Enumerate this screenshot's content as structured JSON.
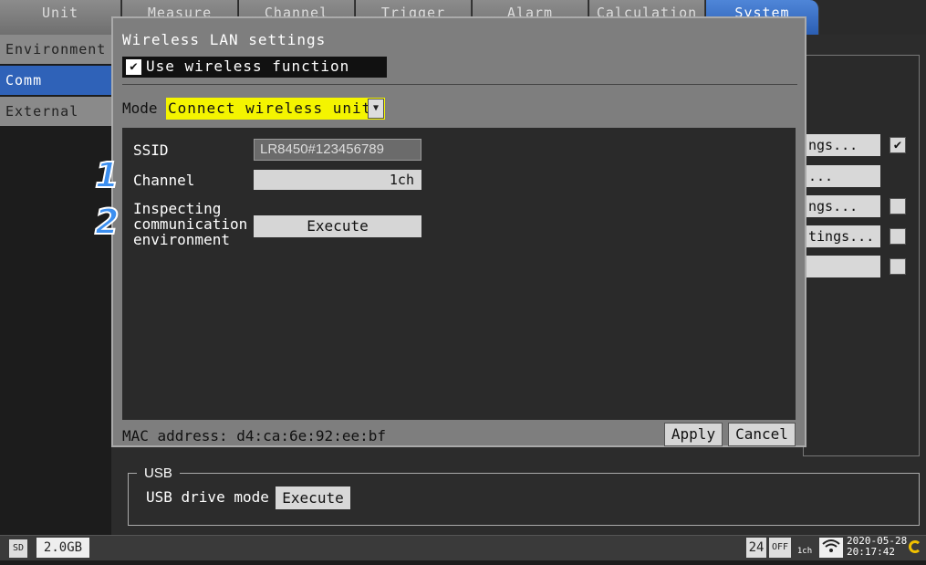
{
  "tabs": [
    {
      "label": "Unit"
    },
    {
      "label": "Measure"
    },
    {
      "label": "Channel"
    },
    {
      "label": "Trigger"
    },
    {
      "label": "Alarm"
    },
    {
      "label": "Calculation"
    },
    {
      "label": "System"
    }
  ],
  "sidebar": {
    "items": [
      {
        "label": "Environment"
      },
      {
        "label": "Comm"
      },
      {
        "label": "External"
      }
    ]
  },
  "background": {
    "buttons": [
      {
        "label": "ngs..."
      },
      {
        "label": "..."
      },
      {
        "label": "ngs..."
      },
      {
        "label": "tings..."
      },
      {
        "label": ""
      }
    ],
    "checks": [
      true,
      false,
      false,
      false
    ]
  },
  "dialog": {
    "title": "Wireless LAN settings",
    "use_wireless_label": "Use wireless function",
    "use_wireless_checked": true,
    "check_glyph": "✔",
    "mode_label": "Mode",
    "mode_value": "Connect wireless unit",
    "ssid_label": "SSID",
    "ssid_value": "LR8450#123456789",
    "channel_label": "Channel",
    "channel_value": "1ch",
    "inspect_label_1": "Inspecting",
    "inspect_label_2": "communication",
    "inspect_label_3": "environment",
    "execute_label": "Execute",
    "mac_address": "MAC address: d4:ca:6e:92:ee:bf",
    "apply_label": "Apply",
    "cancel_label": "Cancel"
  },
  "usb": {
    "group_label": "USB",
    "drive_mode_label": "USB drive mode",
    "execute_label": "Execute"
  },
  "status": {
    "sd_icon": "SD",
    "sd_free": "2.0GB",
    "badge_24": "24",
    "badge_off": "OFF",
    "wifi_channel": "1ch",
    "date": "2020-05-28",
    "time": "20:17:42"
  },
  "steps": [
    "1",
    "2"
  ],
  "colors": {
    "active_tab": "#2b5eb3",
    "mode_highlight": "#f4f400",
    "step_marker": "#3c8ff0"
  }
}
